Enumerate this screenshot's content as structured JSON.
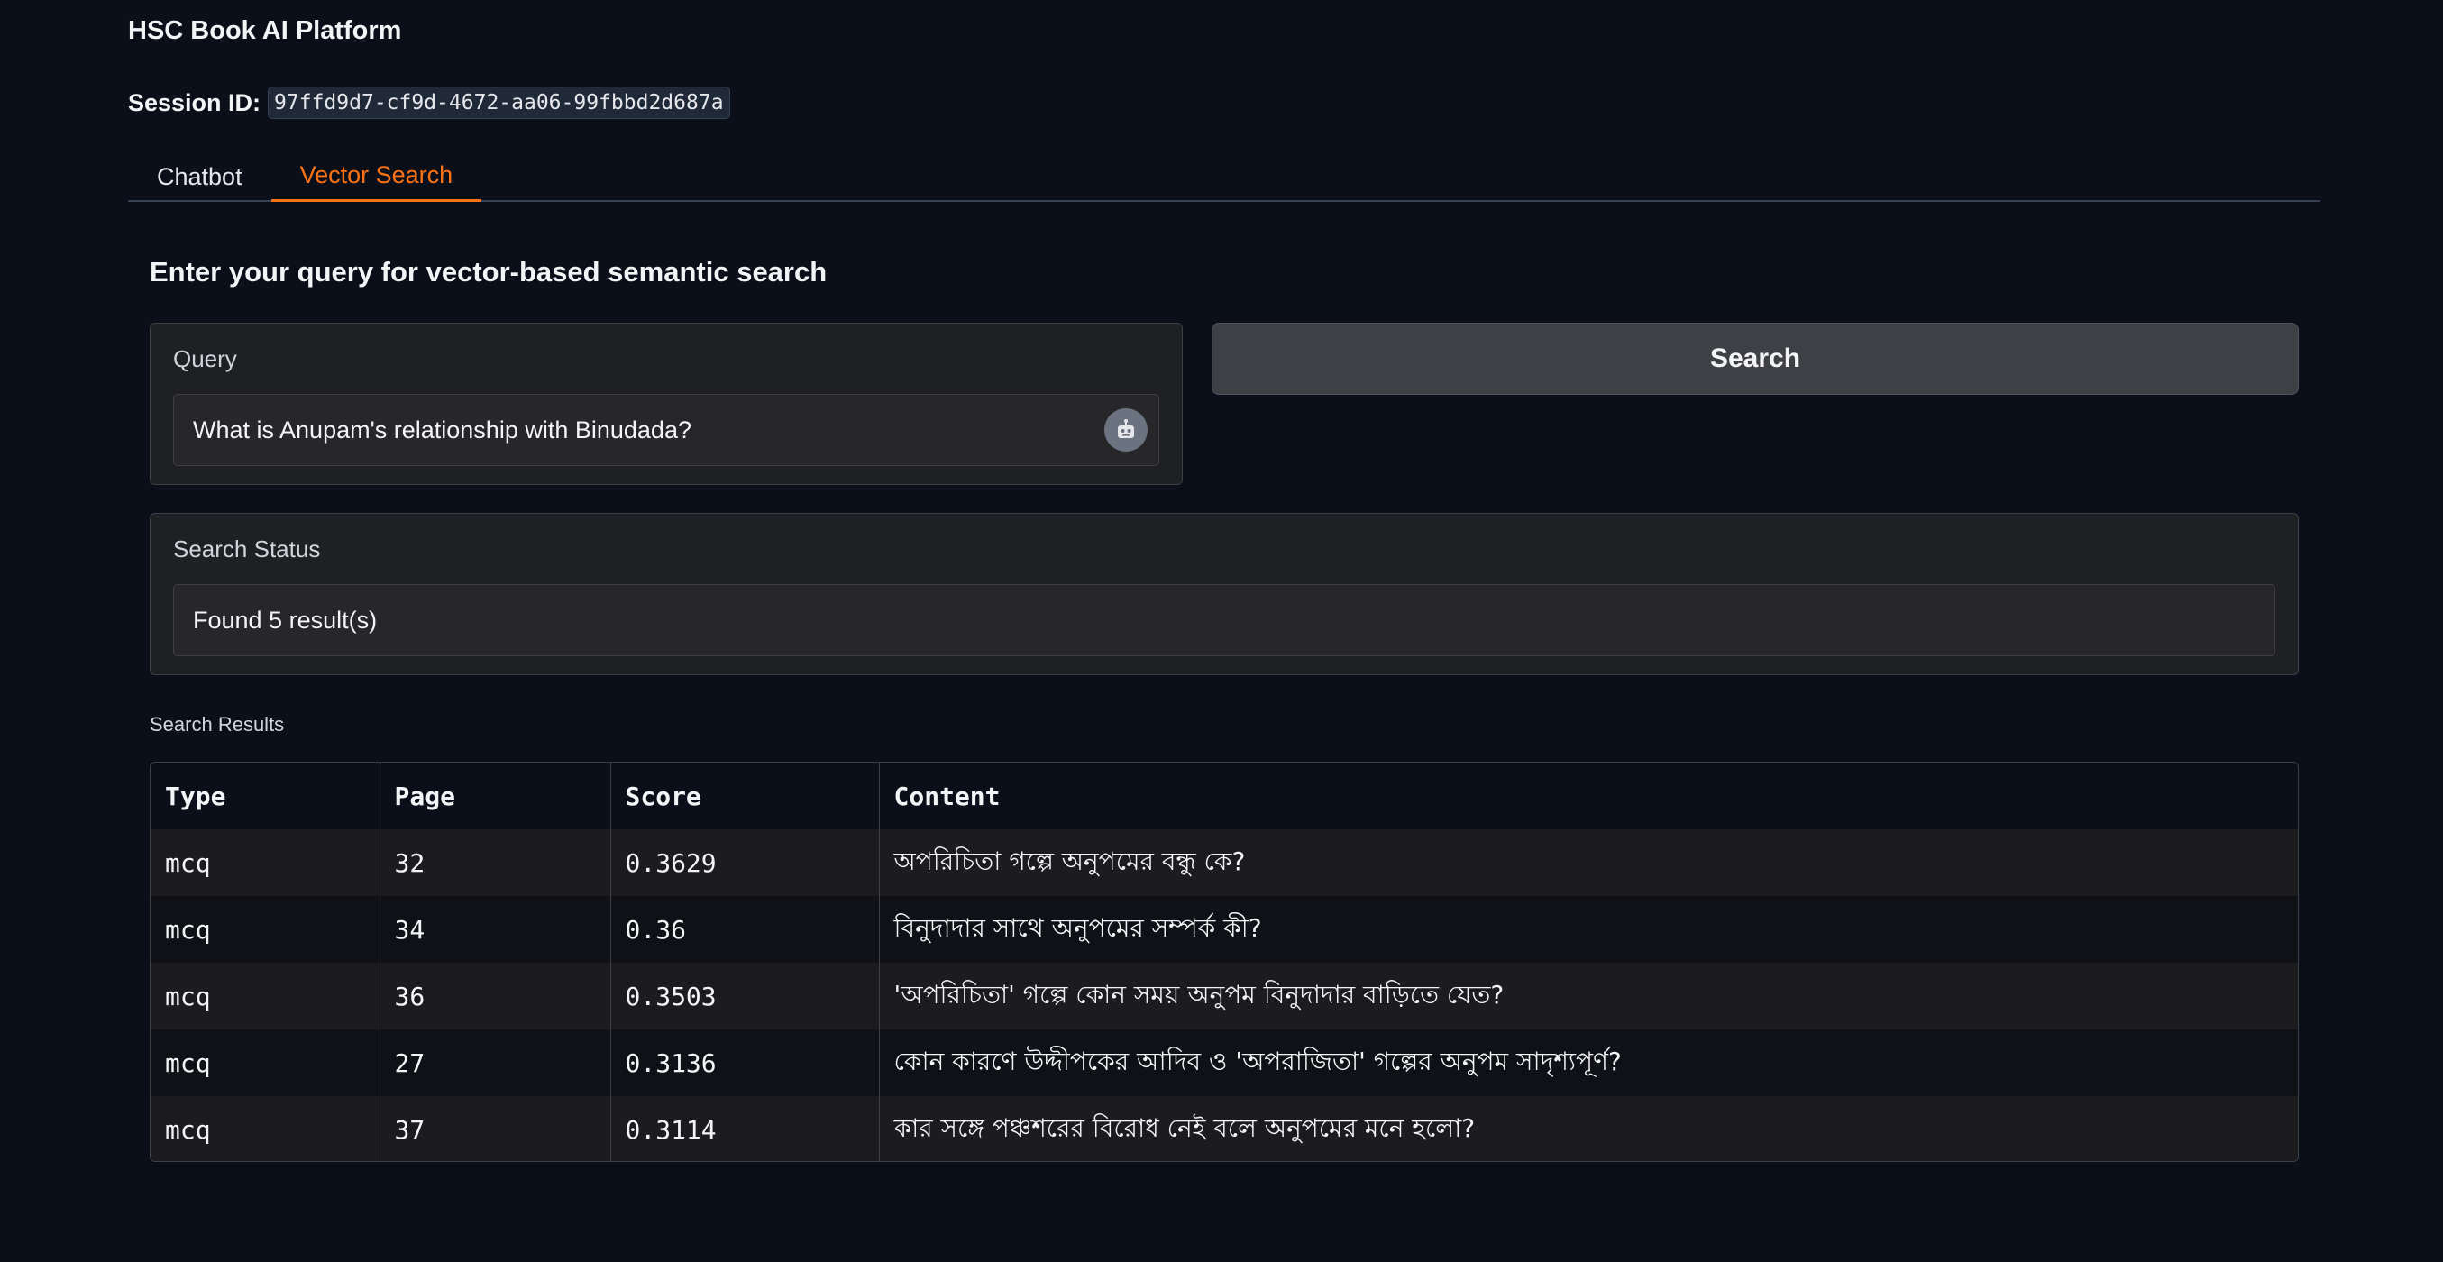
{
  "app": {
    "title": "HSC Book AI Platform"
  },
  "session": {
    "label": "Session ID:",
    "id": "97ffd9d7-cf9d-4672-aa06-99fbbd2d687a"
  },
  "tabs": [
    {
      "label": "Chatbot",
      "active": false
    },
    {
      "label": "Vector Search",
      "active": true
    }
  ],
  "vector_search": {
    "heading": "Enter your query for vector-based semantic search",
    "query_label": "Query",
    "query_value": "What is Anupam's relationship with Binudada?",
    "search_button_label": "Search",
    "status_label": "Search Status",
    "status_value": "Found 5 result(s)",
    "results_label": "Search Results",
    "columns": [
      "Type",
      "Page",
      "Score",
      "Content"
    ],
    "rows": [
      {
        "type": "mcq",
        "page": "32",
        "score": "0.3629",
        "content": "অপরিচিতা গল্পে অনুপমের বন্ধু কে?"
      },
      {
        "type": "mcq",
        "page": "34",
        "score": "0.36",
        "content": "বিনুদাদার সাথে অনুপমের সম্পর্ক কী?"
      },
      {
        "type": "mcq",
        "page": "36",
        "score": "0.3503",
        "content": "'অপরিচিতা' গল্পে কোন সময় অনুপম বিনুদাদার বাড়িতে যেত?"
      },
      {
        "type": "mcq",
        "page": "27",
        "score": "0.3136",
        "content": "কোন কারণে উদ্দীপকের আদিব ও 'অপরাজিতা' গল্পের অনুপম সাদৃশ্যপূর্ণ?"
      },
      {
        "type": "mcq",
        "page": "37",
        "score": "0.3114",
        "content": "কার সঙ্গে পঞ্চশরের বিরোধ নেই বলে অনুপমের মনে হলো?"
      }
    ]
  },
  "colors": {
    "background": "#0b0f19",
    "accent": "#f97316",
    "panel": "#1f2023",
    "button": "#3f3f46"
  },
  "icons": {
    "query_action": "robot-icon"
  }
}
